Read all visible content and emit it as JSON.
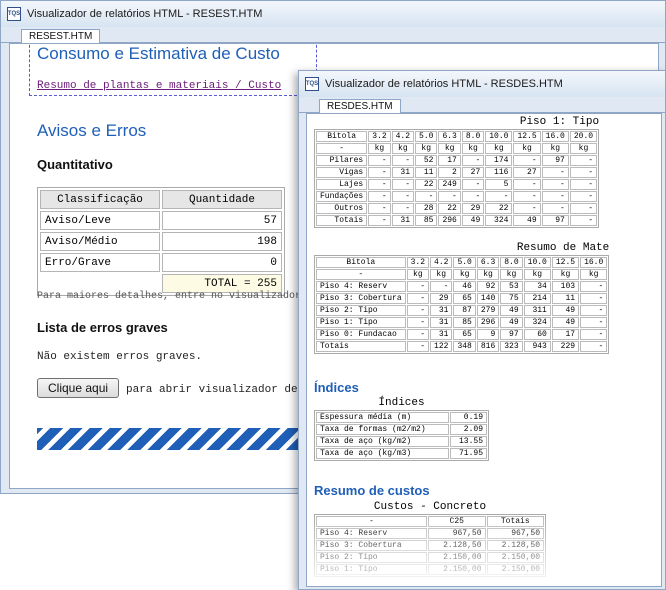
{
  "window1": {
    "title": "Visualizador de relatórios HTML - RESEST.HTM",
    "tab": "RESEST.HTM",
    "heading": "Consumo e Estimativa de Custo",
    "link": "Resumo de plantas e materiais / Custo",
    "avisos_title": "Avisos e Erros",
    "quantitativo": "Quantitativo",
    "table": {
      "headers": [
        "Classificação",
        "Quantidade"
      ],
      "rows": [
        [
          "Aviso/Leve",
          "57"
        ],
        [
          "Aviso/Médio",
          "198"
        ],
        [
          "Erro/Grave",
          "0"
        ]
      ],
      "total": "TOTAL = 255"
    },
    "details_note": "Para maiores detalhes, entre no visualizador d",
    "lista_title": "Lista de erros graves",
    "no_errors": "Não existem erros graves.",
    "button_label": "Clique aqui",
    "button_note": "para abrir visualizador de"
  },
  "window2": {
    "title": "Visualizador de relatórios HTML - RESDES.HTM",
    "tab": "RESDES.HTM",
    "piso_table": {
      "caption": "Piso 1: Tipo",
      "headers": [
        "Bitola",
        "3.2",
        "4.2",
        "5.0",
        "6.3",
        "8.0",
        "10.0",
        "12.5",
        "16.0",
        "20.0"
      ],
      "unit_row": [
        "-",
        "kg",
        "kg",
        "kg",
        "kg",
        "kg",
        "kg",
        "kg",
        "kg",
        "kg"
      ],
      "rows": [
        [
          "Pilares",
          "-",
          "-",
          "52",
          "17",
          "-",
          "174",
          "-",
          "97",
          "-"
        ],
        [
          "Vigas",
          "-",
          "31",
          "11",
          "2",
          "27",
          "116",
          "27",
          "-",
          "-"
        ],
        [
          "Lajes",
          "-",
          "-",
          "22",
          "249",
          "-",
          "5",
          "-",
          "-",
          "-"
        ],
        [
          "Fundações",
          "-",
          "-",
          "-",
          "-",
          "-",
          "-",
          "-",
          "-",
          "-"
        ],
        [
          "Outros",
          "-",
          "-",
          "28",
          "22",
          "29",
          "22",
          "-",
          "-",
          "-"
        ],
        [
          "Totais",
          "-",
          "31",
          "85",
          "296",
          "49",
          "324",
          "49",
          "97",
          "-"
        ]
      ]
    },
    "resumo_table": {
      "caption": "Resumo de Mate",
      "headers": [
        "Bitola",
        "3.2",
        "4.2",
        "5.0",
        "6.3",
        "8.0",
        "10.0",
        "12.5",
        "16.0"
      ],
      "unit_row": [
        "-",
        "kg",
        "kg",
        "kg",
        "kg",
        "kg",
        "kg",
        "kg",
        "kg"
      ],
      "rows": [
        [
          "Piso 4: Reserv",
          "-",
          "-",
          "46",
          "92",
          "53",
          "34",
          "103",
          "-"
        ],
        [
          "Piso 3: Cobertura",
          "-",
          "29",
          "65",
          "140",
          "75",
          "214",
          "11",
          "-"
        ],
        [
          "Piso 2: Tipo",
          "-",
          "31",
          "87",
          "279",
          "49",
          "311",
          "49",
          "-"
        ],
        [
          "Piso 1: Tipo",
          "-",
          "31",
          "85",
          "296",
          "49",
          "324",
          "49",
          "-"
        ],
        [
          "Piso 0: Fundacao",
          "-",
          "31",
          "65",
          "9",
          "97",
          "60",
          "17",
          "-"
        ],
        [
          "Totais",
          "-",
          "122",
          "348",
          "816",
          "323",
          "943",
          "229",
          "-"
        ]
      ]
    },
    "indices_title": "Índices",
    "indices_table": {
      "caption": "Índices",
      "rows": [
        [
          "Espessura média (m)",
          "0.19"
        ],
        [
          "Taxa de formas (m2/m2)",
          "2.09"
        ],
        [
          "Taxa de aço (kg/m2)",
          "13.55"
        ],
        [
          "Taxa de aço (kg/m3)",
          "71.95"
        ]
      ]
    },
    "custos_title": "Resumo de custos",
    "custos_table": {
      "caption": "Custos - Concreto",
      "headers": [
        "-",
        "C25",
        "Totais"
      ],
      "rows": [
        [
          "Piso 4: Reserv",
          "967,50",
          "967,50"
        ],
        [
          "Piso 3: Cobertura",
          "2.128,50",
          "2.128,50"
        ],
        [
          "Piso 2: Tipo",
          "2.150,00",
          "2.150,00"
        ],
        [
          "Piso 1: Tipo",
          "2.150,00",
          "2.150,00"
        ]
      ]
    }
  },
  "icon_text": "TQS"
}
